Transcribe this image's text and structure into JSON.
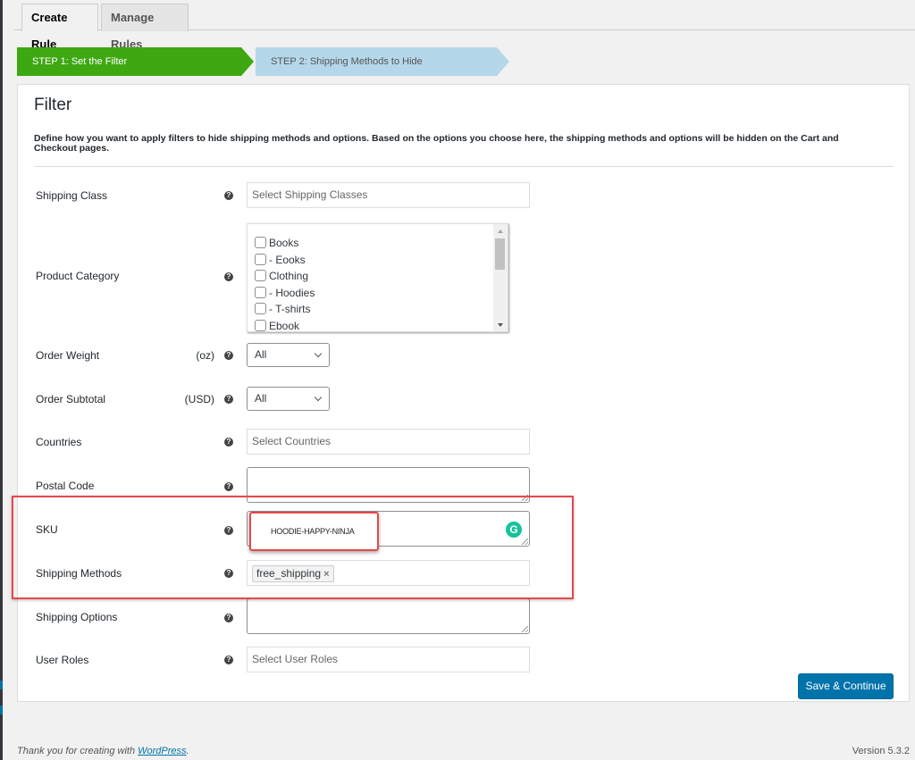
{
  "tabs": [
    {
      "label": "Create Rule",
      "active": true
    },
    {
      "label": "Manage Rules",
      "active": false
    }
  ],
  "steps": [
    {
      "label": "STEP 1: Set the Filter",
      "active": true,
      "color": "#3ea812"
    },
    {
      "label": "STEP 2: Shipping Methods to Hide",
      "active": false,
      "color": "#b5d7ea"
    }
  ],
  "panel": {
    "title": "Filter",
    "description": "Define how you want to apply filters to hide shipping methods and options. Based on the options you choose here, the shipping methods and options will be hidden on the Cart and Checkout pages."
  },
  "help_icon_glyph": "?",
  "fields": {
    "shipping_class": {
      "label": "Shipping Class",
      "placeholder": "Select Shipping Classes"
    },
    "product_category": {
      "label": "Product Category",
      "options": [
        {
          "label": "Books",
          "checked": false
        },
        {
          "label": "- Eooks",
          "checked": false
        },
        {
          "label": "Clothing",
          "checked": false
        },
        {
          "label": "- Hoodies",
          "checked": false
        },
        {
          "label": "- T-shirts",
          "checked": false
        },
        {
          "label": "Ebook",
          "checked": false
        }
      ]
    },
    "order_weight": {
      "label": "Order Weight",
      "unit": "(oz)",
      "value": "All"
    },
    "order_subtotal": {
      "label": "Order Subtotal",
      "unit": "(USD)",
      "value": "All"
    },
    "countries": {
      "label": "Countries",
      "placeholder": "Select Countries"
    },
    "postal_code": {
      "label": "Postal Code",
      "value": ""
    },
    "sku": {
      "label": "SKU",
      "value": "HOODIE-HAPPY-NINJA"
    },
    "shipping_methods": {
      "label": "Shipping Methods",
      "tags": [
        "free_shipping"
      ],
      "remove_glyph": "×"
    },
    "shipping_options": {
      "label": "Shipping Options",
      "value": ""
    },
    "user_roles": {
      "label": "User Roles",
      "placeholder": "Select User Roles"
    }
  },
  "grammarly_glyph": "G",
  "save_button": "Save & Continue",
  "footer": {
    "thanks_prefix": "Thank you for creating with ",
    "thanks_link": "WordPress",
    "thanks_suffix": ".",
    "version": "Version 5.3.2"
  },
  "colors": {
    "primary": "#0073aa",
    "step_active": "#3ea812",
    "step_inactive": "#b5d7ea",
    "highlight": "#e8474a"
  }
}
